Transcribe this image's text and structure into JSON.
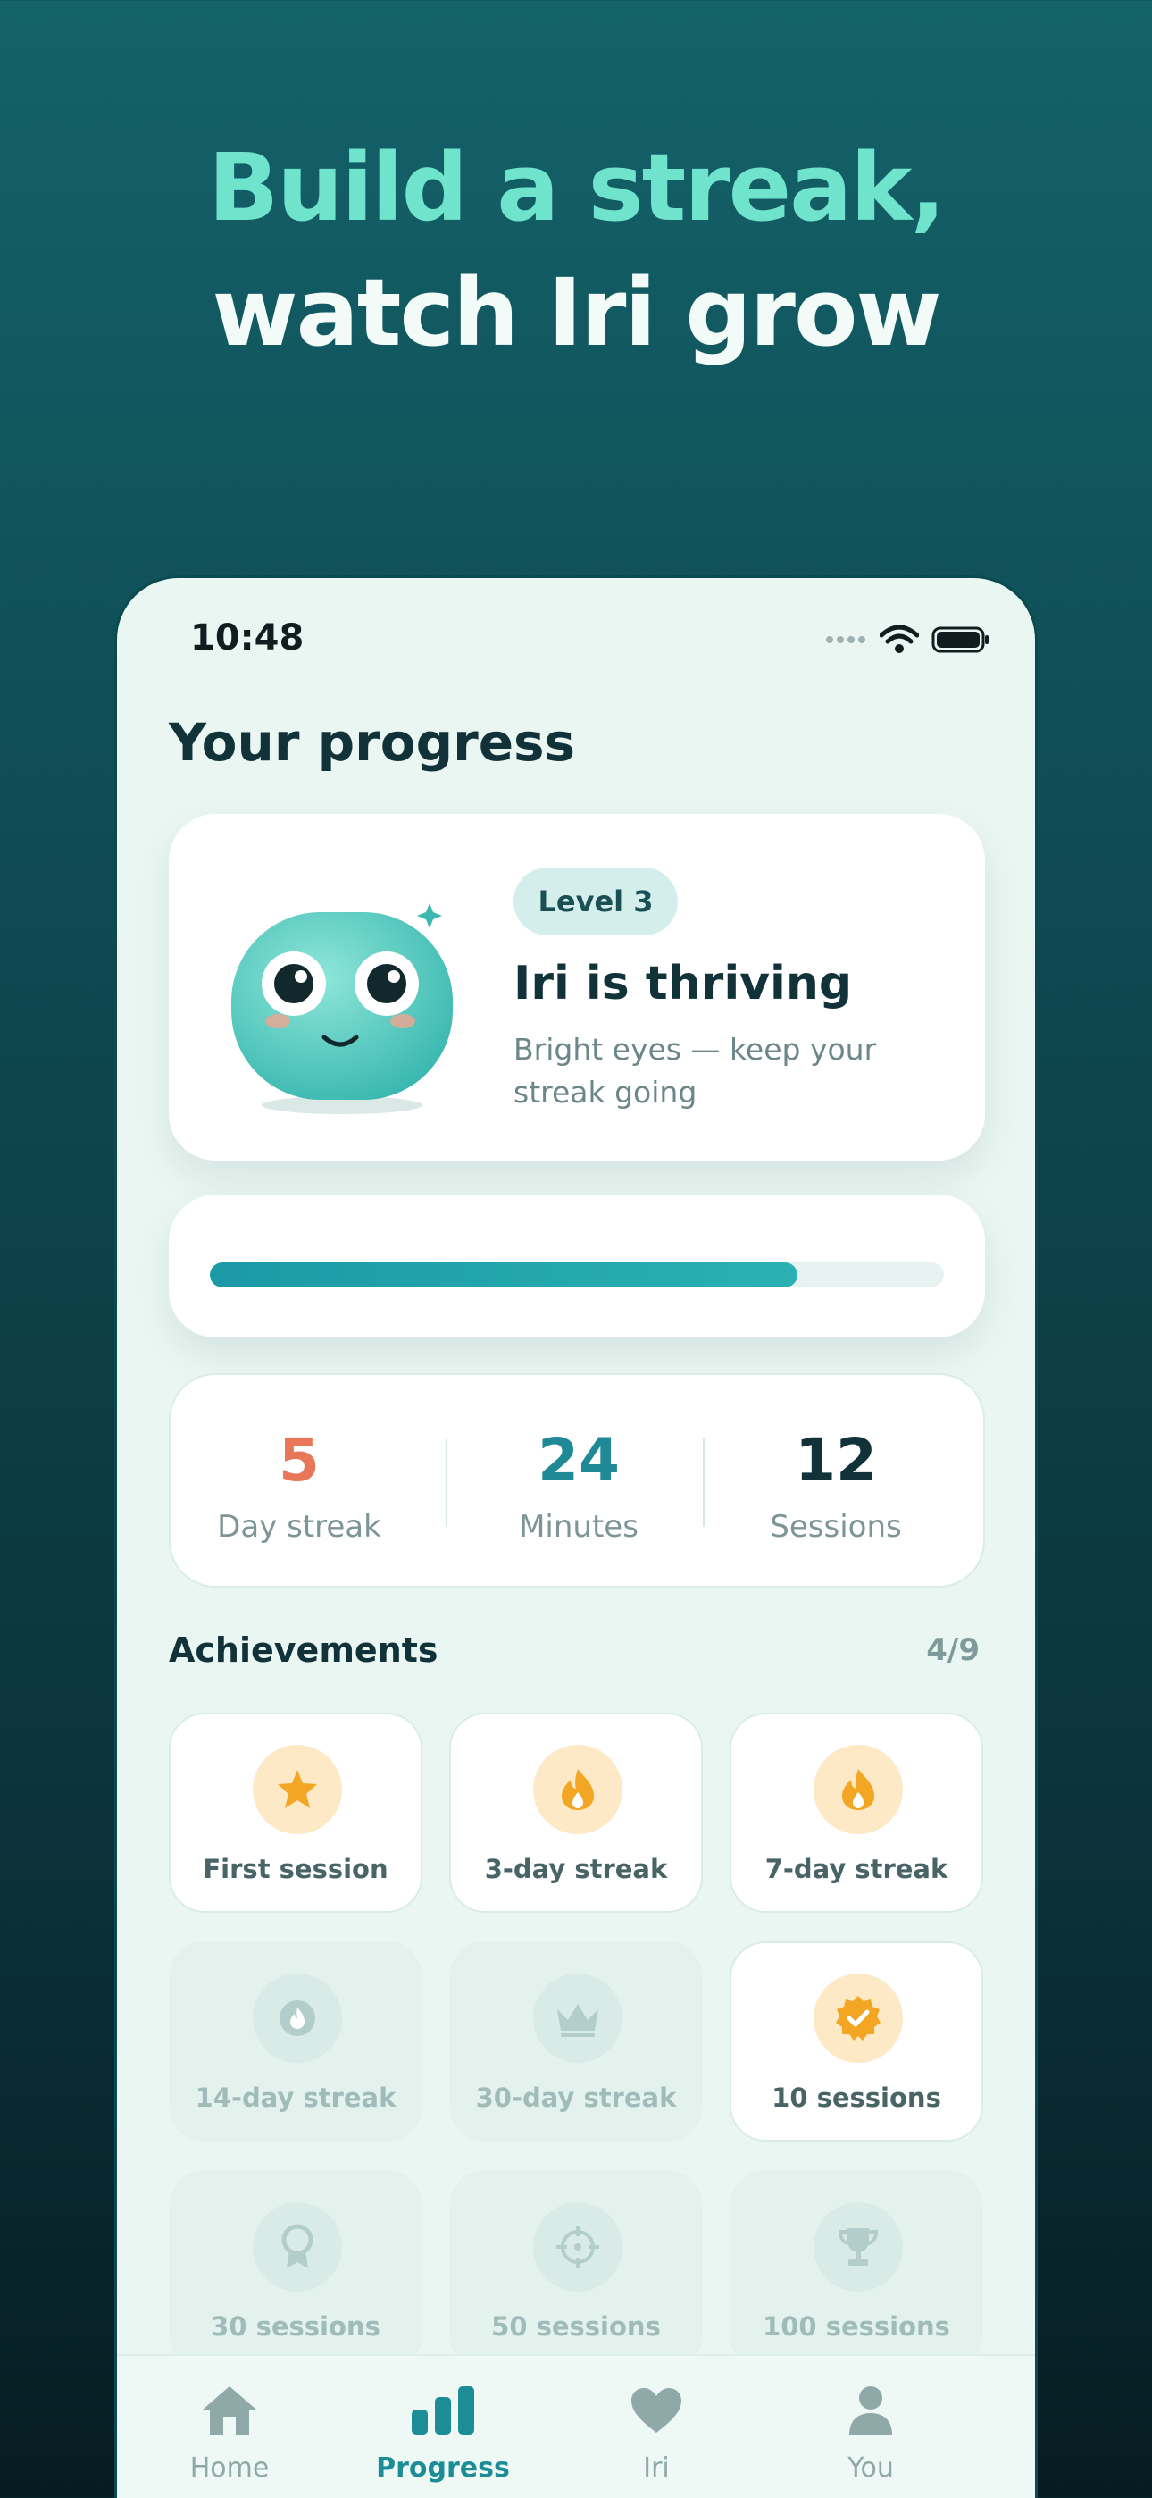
{
  "headline": {
    "line1": "Build a streak,",
    "line2": "watch Iri grow"
  },
  "status_bar": {
    "time": "10:48"
  },
  "page_title": "Your progress",
  "hero": {
    "level": "Level 3",
    "title": "Iri is thriving",
    "subtitle": "Bright eyes — keep your streak going"
  },
  "progress": {
    "fraction": 0.8
  },
  "stats": [
    {
      "value": "5",
      "label": "Day streak",
      "color": "#e8775a"
    },
    {
      "value": "24",
      "label": "Minutes",
      "color": "#1f8a95"
    },
    {
      "value": "12",
      "label": "Sessions",
      "color": "#113238"
    }
  ],
  "achievements": {
    "title": "Achievements",
    "count": "4/9",
    "items": [
      {
        "label": "First session",
        "icon": "star-icon",
        "unlocked": true
      },
      {
        "label": "3-day streak",
        "icon": "flame-icon",
        "unlocked": true
      },
      {
        "label": "7-day streak",
        "icon": "flame-icon",
        "unlocked": true
      },
      {
        "label": "14-day streak",
        "icon": "flame-icon",
        "unlocked": false
      },
      {
        "label": "30-day streak",
        "icon": "crown-icon",
        "unlocked": false
      },
      {
        "label": "10 sessions",
        "icon": "badge-check-icon",
        "unlocked": true
      },
      {
        "label": "30 sessions",
        "icon": "ribbon-icon",
        "unlocked": false
      },
      {
        "label": "50 sessions",
        "icon": "target-icon",
        "unlocked": false
      },
      {
        "label": "100 sessions",
        "icon": "trophy-icon",
        "unlocked": false
      }
    ]
  },
  "tabs": [
    {
      "label": "Home",
      "icon": "home-icon",
      "active": false
    },
    {
      "label": "Progress",
      "icon": "bar-chart-icon",
      "active": true
    },
    {
      "label": "Iri",
      "icon": "heart-icon",
      "active": false
    },
    {
      "label": "You",
      "icon": "person-icon",
      "active": false
    }
  ],
  "colors": {
    "accent": "#1c8c96",
    "headline_mint": "#6fe3cc",
    "streak_orange": "#e8775a",
    "achievement_gold": "#f2a623"
  }
}
